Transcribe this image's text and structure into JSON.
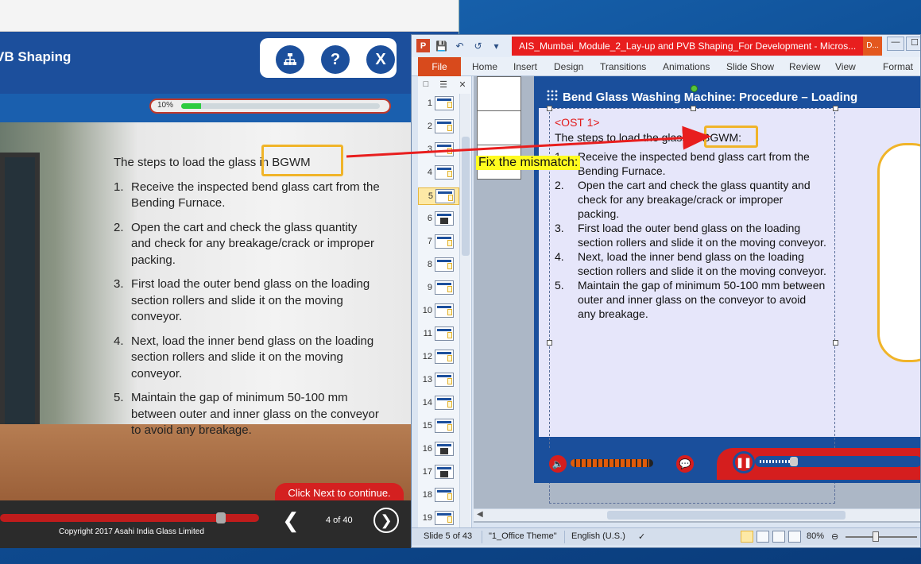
{
  "player": {
    "title": "VB Shaping",
    "header_buttons": [
      {
        "icon": "sitemap-icon",
        "label": ""
      },
      {
        "icon": "help-icon",
        "label": "?"
      },
      {
        "icon": "close-icon",
        "label": "X"
      }
    ],
    "progress": {
      "label": "10%",
      "value": 0.1
    },
    "intro": "The steps to load the glass in BGWM",
    "steps": [
      {
        "num": "1.",
        "text": "Receive the inspected bend glass cart from the Bending Furnace."
      },
      {
        "num": "2.",
        "text": "Open the cart and check the glass quantity and check for any breakage/crack or improper packing."
      },
      {
        "num": "3.",
        "text": "First load the outer bend glass on the loading section rollers and slide it on the moving conveyor."
      },
      {
        "num": "4.",
        "text": "Next, load the inner bend glass on the loading section rollers and slide it on the moving conveyor."
      },
      {
        "num": "5.",
        "text": "Maintain the gap of minimum 50-100 mm between outer and inner glass on the conveyor to avoid any breakage."
      }
    ],
    "next_hint": "Click Next to continue.",
    "copyright": "Copyright 2017 Asahi India Glass Limited",
    "page_indicator": "4 of 40",
    "seek_value": 0.86
  },
  "ppt": {
    "doc_title": "AIS_Mumbai_Module_2_Lay-up and PVB Shaping_For Development  -  Micros...",
    "doc_title_right": "D...",
    "file_tab": "File",
    "ribbon_tabs": [
      "Home",
      "Insert",
      "Design",
      "Transitions",
      "Animations",
      "Slide Show",
      "Review",
      "View",
      "Format"
    ],
    "slide_numbers": [
      "1",
      "2",
      "3",
      "4",
      "5",
      "6",
      "7",
      "8",
      "9",
      "10",
      "11",
      "12",
      "13",
      "14",
      "15",
      "16",
      "17",
      "18",
      "19"
    ],
    "selected_slide": "5",
    "slide": {
      "title": "Bend Glass Washing  Machine: Procedure – Loading",
      "ost": "<OST 1>",
      "intro": "The steps to load the glass in BGWM:",
      "steps": [
        {
          "num": "1.",
          "text": "Receive the inspected bend glass cart from the Bending Furnace."
        },
        {
          "num": "2.",
          "text": "Open the cart and check the glass quantity and check for any breakage/crack or improper packing."
        },
        {
          "num": "3.",
          "text": "First load the outer bend glass on the loading section rollers and slide it on the moving conveyor."
        },
        {
          "num": "4.",
          "text": "Next, load the inner bend glass on the loading section rollers and slide it on the moving conveyor."
        },
        {
          "num": "5.",
          "text": "Maintain  the gap of minimum 50-100 mm between outer and inner glass on the conveyor to avoid any breakage."
        }
      ]
    },
    "status": {
      "slide_of": "Slide 5 of 43",
      "theme": "\"1_Office Theme\"",
      "language": "English (U.S.)",
      "zoom": "80%"
    }
  },
  "annotation": {
    "callout": "Fix the mismatch:",
    "arrow_color": "#e81e1e",
    "highlight_color": "#f0b429"
  }
}
